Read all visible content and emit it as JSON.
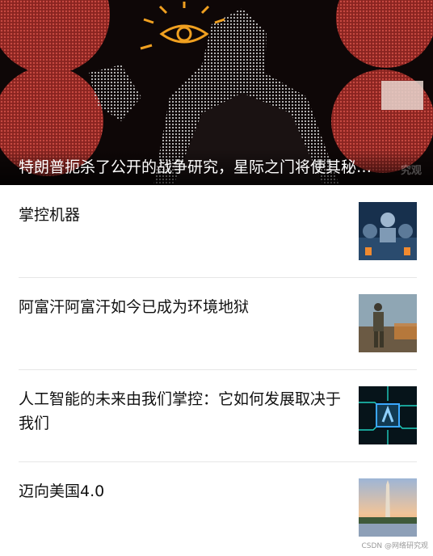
{
  "hero": {
    "title": "特朗普扼杀了公开的战争研究，星际之门将使其秘…",
    "watermark": "究观",
    "colors": {
      "background": "#0e0707",
      "accent_red": "#b2322e",
      "eye_orange": "#f0a020"
    }
  },
  "articles": [
    {
      "title": "掌控机器",
      "thumb_icon": "robot-image"
    },
    {
      "title": "阿富汗阿富汗如今已成为环境地狱",
      "thumb_icon": "soldier-landscape-image"
    },
    {
      "title": "人工智能的未来由我们掌控：它如何发展取决于我们",
      "thumb_icon": "ai-chip-image"
    },
    {
      "title": "迈向美国4.0",
      "thumb_icon": "washington-monument-image"
    }
  ],
  "footer": {
    "watermark": "CSDN @网络研究观"
  }
}
